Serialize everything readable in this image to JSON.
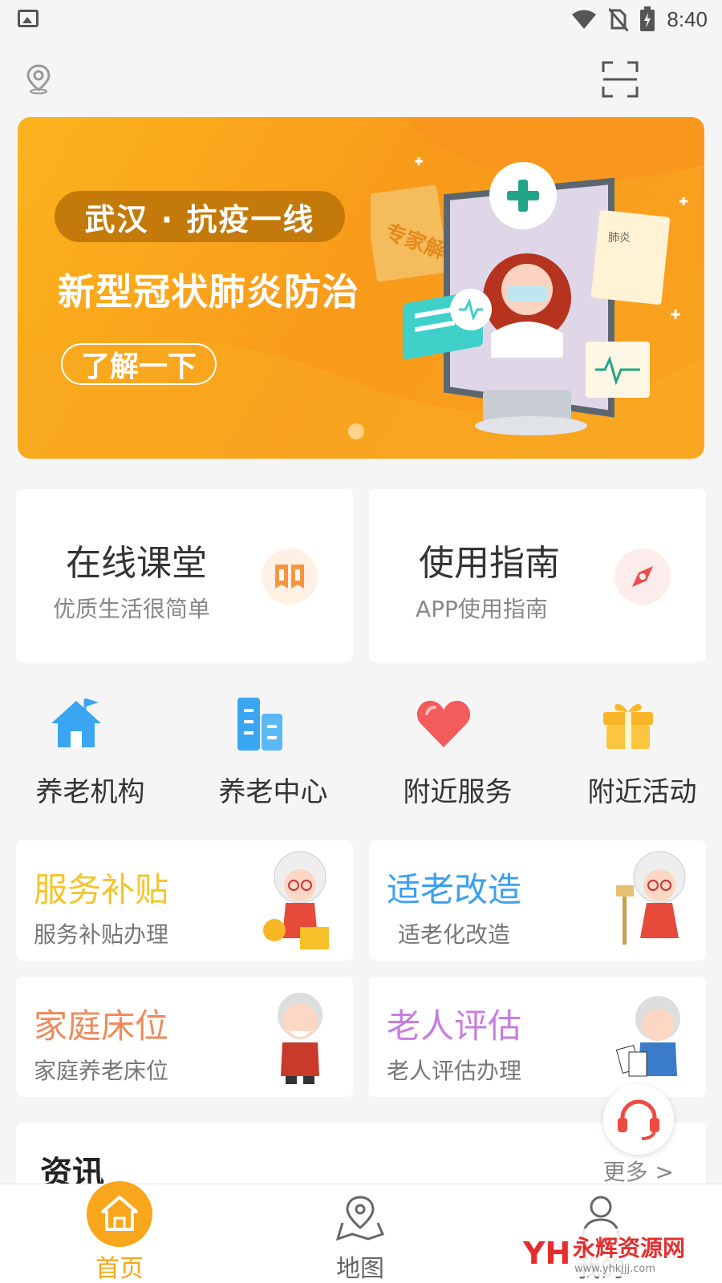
{
  "status_bar": {
    "time": "8:40",
    "icons": [
      "image-icon",
      "wifi-icon",
      "no-sim-icon",
      "battery-icon"
    ]
  },
  "header": {
    "location_icon": "location-pin-icon",
    "scan_icon": "scan-icon"
  },
  "banner": {
    "tag": "武汉 · 抗疫一线",
    "title": "新型冠状肺炎防治",
    "button": "了解一下",
    "side_text": "专家解读",
    "sheet_text": "肺炎",
    "slide_count": 1,
    "active_slide": 1,
    "colors": {
      "bg": "#f9a420",
      "tag_bg": "#c47a0a",
      "dot": "#fcd38b"
    }
  },
  "feature_cards": [
    {
      "title": "在线课堂",
      "subtitle": "优质生活很简单",
      "icon": "book-icon",
      "icon_bg": "#fff0e4",
      "icon_color": "#f8943e"
    },
    {
      "title": "使用指南",
      "subtitle": "APP使用指南",
      "icon": "compass-icon",
      "icon_bg": "#fdecec",
      "icon_color": "#ef4b4b"
    }
  ],
  "quick_nav": [
    {
      "label": "养老机构",
      "icon": "house-icon"
    },
    {
      "label": "养老中心",
      "icon": "building-icon"
    },
    {
      "label": "附近服务",
      "icon": "heart-icon"
    },
    {
      "label": "附近活动",
      "icon": "gift-icon"
    }
  ],
  "services": [
    {
      "title": "服务补贴",
      "subtitle": "服务补贴办理",
      "color": "#f5c42a",
      "figure": "grandma-coins-illustration"
    },
    {
      "title": "适老改造",
      "subtitle": "适老化改造",
      "color": "#3ba0f0",
      "figure": "grandma-sign-illustration"
    },
    {
      "title": "家庭床位",
      "subtitle": "家庭养老床位",
      "color": "#f08a5a",
      "figure": "grandpa-illustration"
    },
    {
      "title": "老人评估",
      "subtitle": "老人评估办理",
      "color": "#c77de0",
      "figure": "grandpa-cards-illustration"
    }
  ],
  "news": {
    "title": "资讯",
    "more": "更多 >"
  },
  "tabs": [
    {
      "label": "首页",
      "icon": "home-icon",
      "active": true
    },
    {
      "label": "地图",
      "icon": "map-icon",
      "active": false
    },
    {
      "label": "我的",
      "icon": "user-icon",
      "active": false
    }
  ],
  "watermark": {
    "logo": "YH",
    "text": "永辉资源网",
    "url": "www.yhkjjj.com"
  },
  "colors": {
    "accent": "#f6a516",
    "bg": "#f5f5f5"
  }
}
